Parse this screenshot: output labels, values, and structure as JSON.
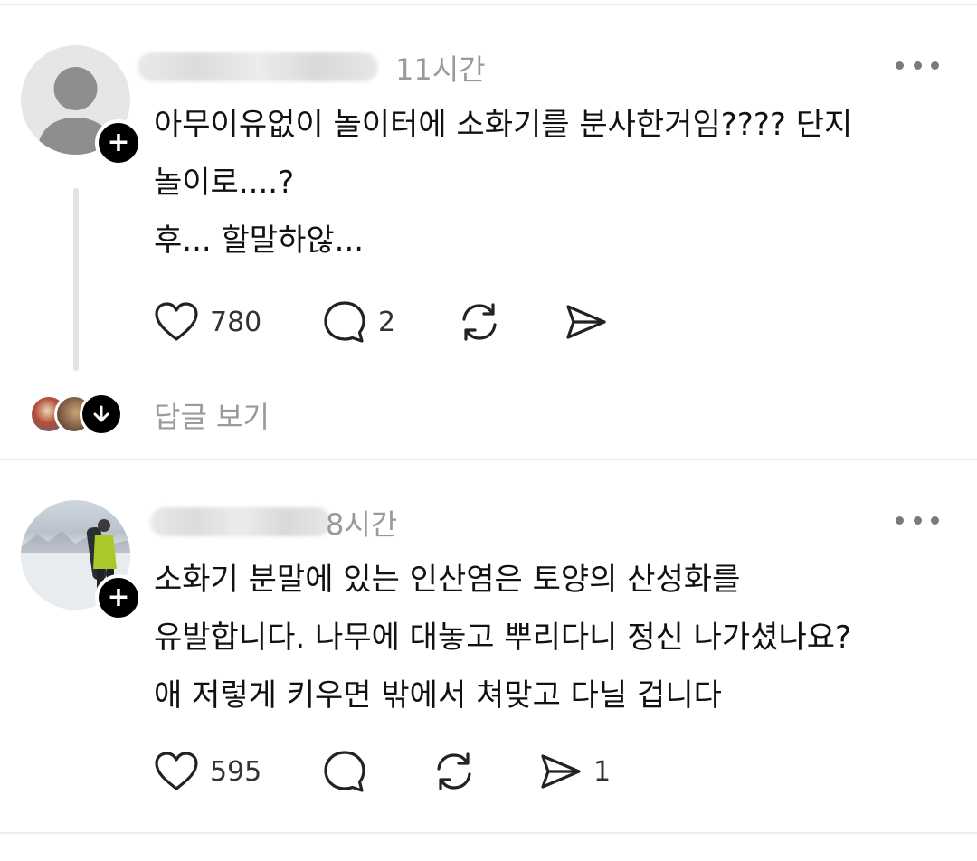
{
  "colors": {
    "text": "#111111",
    "muted": "#9a9a9a",
    "divider": "#eeeeee",
    "icon": "#222222",
    "follow_badge": "#000000"
  },
  "posts": [
    {
      "timestamp": "11시간",
      "avatar": "default-person-avatar",
      "text_lines": [
        "아무이유없이 놀이터에 소화기를 분사한거임???? 단지",
        "놀이로....?",
        "후... 할말하않..."
      ],
      "like_count": "780",
      "comment_count": "2",
      "has_thread": true,
      "view_replies_label": "답글 보기"
    },
    {
      "timestamp": "8시간",
      "avatar": "snow-photo-avatar",
      "text_lines": [
        "소화기 분말에 있는 인산염은 토양의 산성화를",
        "유발합니다. 나무에 대놓고 뿌리다니 정신 나가셨나요?",
        "애 저렇게 키우면 밖에서 쳐맞고 다닐 겁니다"
      ],
      "like_count": "595",
      "share_count": "1"
    }
  ],
  "icons": {
    "like": "heart-icon",
    "comment": "comment-bubble-icon",
    "repost": "repost-icon",
    "share": "send-icon",
    "more": "more-dots-icon",
    "follow": "plus-icon",
    "expand": "arrow-down-icon"
  }
}
